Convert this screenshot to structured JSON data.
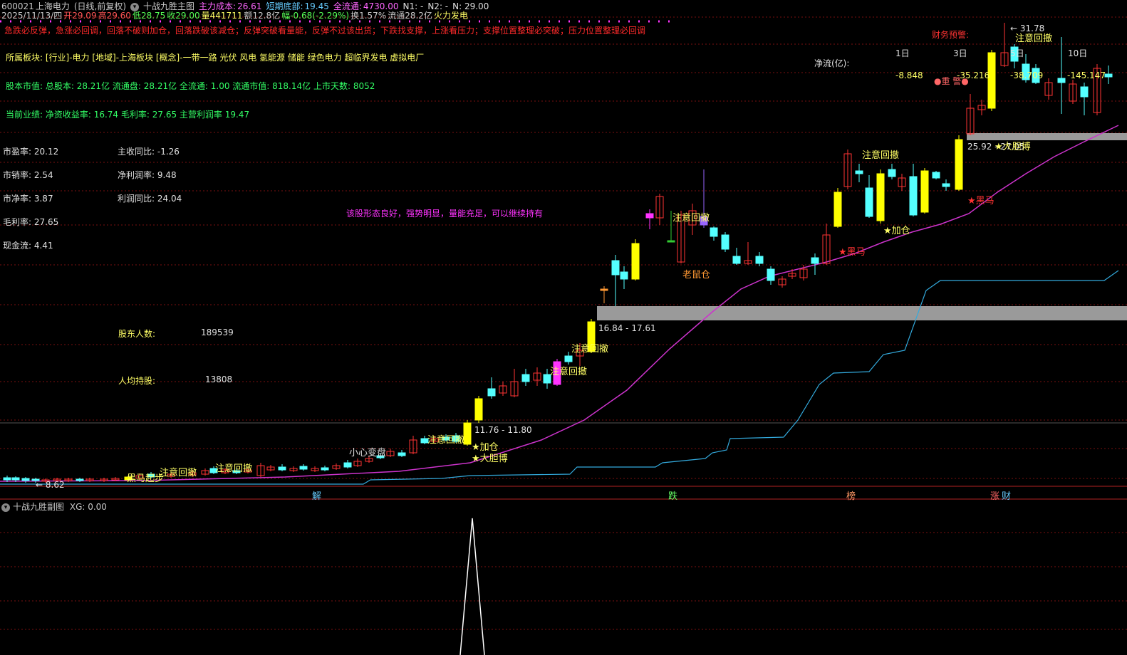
{
  "header": {
    "row1": {
      "code": "600021",
      "name": "上海电力",
      "mode": "(日线,前复权)",
      "indicator": "十战九胜主图",
      "cost_label": "主力成本:",
      "cost_value": "26.61",
      "short_bottom_label": "短期底部:",
      "short_bottom_value": "19.45",
      "float_label": "全流通:",
      "float_value": "4730.00",
      "n1": "N1: -",
      "n2": "N2: -",
      "n": "N: 29.00"
    },
    "row2": {
      "date": "2025/11/13/四",
      "open": "开29.09",
      "high": "高29.60",
      "low": "低28.75",
      "close": "收29.00",
      "volume": "量441711",
      "amount": "额12.8亿",
      "change": "幅-0.68(-2.29%)",
      "turnover": "换1.57%",
      "float_cap": "流通28.2亿",
      "sector": "火力发电"
    }
  },
  "red_banner": "急跌必反弹，急涨必回调，回落不破则加仓，回落跌破该减仓；反弹突破看量能，反弹不过该出货；下跌找支撑，上涨看压力；支撑位置整理必突破；压力位置整理必回调",
  "sector_line": "所属板块: [行业]-电力 [地域]-上海板块 [概念]-一带一路 光伏 风电 氢能源 储能 绿色电力 超临界发电 虚拟电厂",
  "capital_line": "股本市值: 总股本: 28.21亿 流通盘: 28.21亿 全流通: 1.00 流通市值: 818.14亿 上市天数: 8052",
  "performance_line": "当前业绩: 净资收益率: 16.74 毛利率: 27.65 主营利润率 19.47",
  "stats_left": [
    {
      "label": "市盈率: 20.12"
    },
    {
      "label": "市销率: 2.54"
    },
    {
      "label": "市净率: 3.87"
    },
    {
      "label": "毛利率: 27.65"
    },
    {
      "label": "现金流: 4.41"
    }
  ],
  "stats_right": [
    {
      "label": "主收同比: -1.26"
    },
    {
      "label": "净利润率: 9.48"
    },
    {
      "label": "利润同比: 24.04"
    }
  ],
  "shareholders": {
    "label": "股东人数:",
    "value": "189539"
  },
  "per_capita": {
    "label": "人均持股:",
    "value": "13808"
  },
  "comment": "该股形态良好，强势明显，量能充足，可以继续持有",
  "finance_warning": "财务预警:",
  "net_flow": {
    "label": "净流(亿):",
    "periods": [
      "1日",
      "3日",
      "5日",
      "10日"
    ],
    "values": [
      "-8.848",
      "-35.216",
      "-38.709",
      "-145.147"
    ]
  },
  "alert": "●重 警●",
  "price_labels": {
    "high": "31.78",
    "low": "8.62",
    "zone1": "16.84 - 17.61",
    "zone2": "11.76 - 11.80",
    "zone3": "25.92 - 27.05"
  },
  "annotations": [
    {
      "text": "注意回撤",
      "color": "#ffff66"
    },
    {
      "text": "注意回撤",
      "color": "#ffff66"
    },
    {
      "text": "注意回撤",
      "color": "#ffff66"
    },
    {
      "text": "注意回撤",
      "color": "#ffff66"
    },
    {
      "text": "注意回撤",
      "color": "#ffff66"
    },
    {
      "text": "注意回撤",
      "color": "#ffff66"
    },
    {
      "text": "注意回撤",
      "color": "#ffff66"
    },
    {
      "text": "注意回撤",
      "color": "#ffff66"
    },
    {
      "text": "★加仓",
      "color": "#ffff66"
    },
    {
      "text": "★大胆博",
      "color": "#ffff66"
    },
    {
      "text": "★加仓",
      "color": "#ffff66"
    },
    {
      "text": "★大胆博",
      "color": "#ffff66"
    },
    {
      "text": "★黑马",
      "color": "#ff3333"
    },
    {
      "text": "★黑马",
      "color": "#ff3333"
    },
    {
      "text": "黑马起步",
      "color": "#ffff66"
    },
    {
      "text": "小心变盘",
      "color": "#e0e0e0"
    },
    {
      "text": "老鼠仓",
      "color": "#ff9933"
    }
  ],
  "bottom_markers": [
    {
      "text": "解",
      "color": "#66ccff"
    },
    {
      "text": "跌",
      "color": "#66ff66"
    },
    {
      "text": "榜",
      "color": "#ff9966"
    },
    {
      "text": "涨",
      "color": "#ff6666"
    },
    {
      "text": "财",
      "color": "#66ccff"
    }
  ],
  "sub_chart": {
    "title": "十战九胜副图",
    "xg": "XG: 0.00"
  },
  "colors": {
    "up_yellow": "#ffff00",
    "down_cyan": "#54ffff",
    "red": "#ff3333",
    "magenta": "#ff33ff",
    "ma_line": "#cc33cc",
    "cost_line": "#33aadd",
    "zone_gray": "#9a9a9a"
  }
}
